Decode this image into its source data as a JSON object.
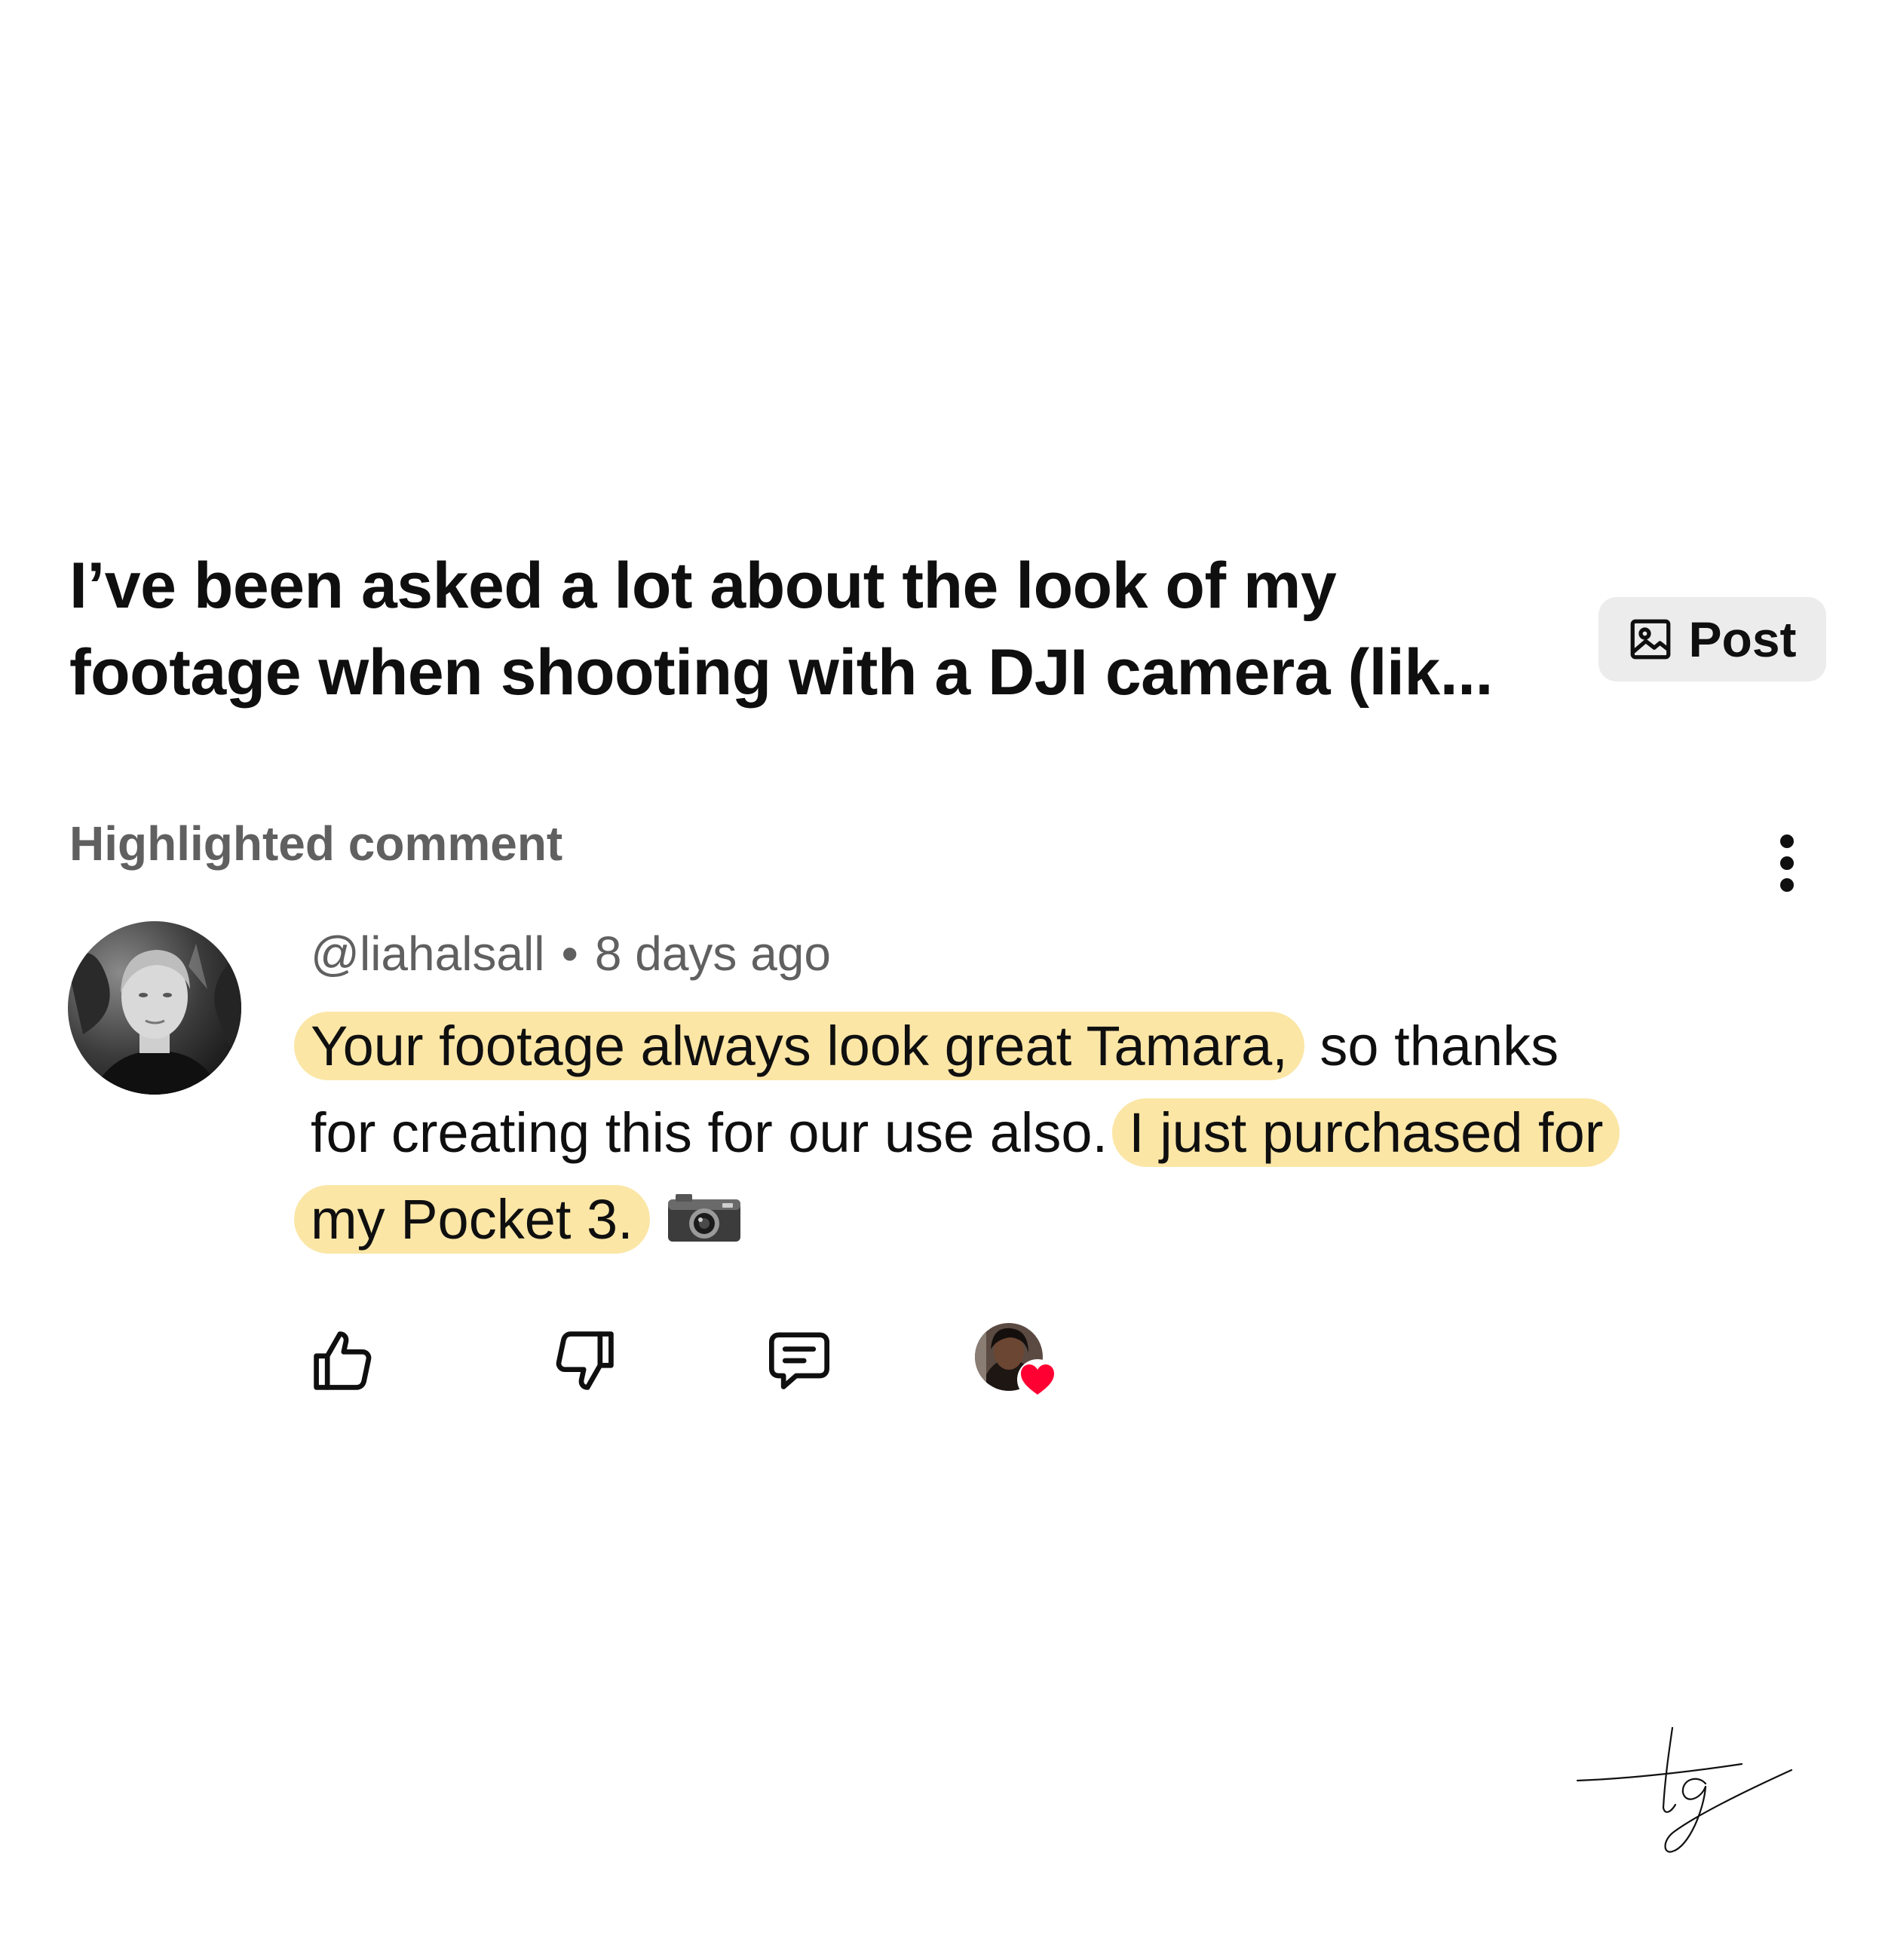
{
  "post": {
    "title_line1": "I’ve been asked a lot about the look of my",
    "title_line2": "footage when shooting with a DJI camera (lik...",
    "post_button_label": "Post",
    "post_button_icon": "image-icon"
  },
  "comment_section": {
    "label": "Highlighted comment",
    "more_icon": "more-vertical-icon"
  },
  "comment": {
    "author": "@liahalsall",
    "separator": "•",
    "time": "8 days ago",
    "text_parts": {
      "highlight1": "Your footage always look great Tamara,",
      "plain1": " so thanks",
      "plain2": "for creating this for our use also.",
      "highlight2": "I just purchased for",
      "highlight3": "my Pocket 3."
    },
    "emoji": "camera-emoji",
    "highlight_color": "#fbe6a6"
  },
  "actions": {
    "like_icon": "thumbs-up-icon",
    "dislike_icon": "thumbs-down-icon",
    "reply_icon": "reply-icon",
    "creator_heart_icon": "heart-icon",
    "heart_color": "#ff0033"
  },
  "watermark": {
    "signature": "tg"
  }
}
